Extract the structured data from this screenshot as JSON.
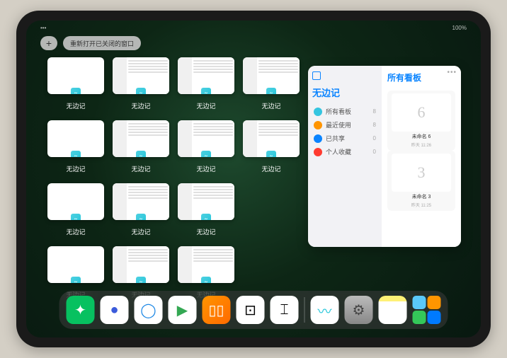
{
  "status": {
    "battery": "100%",
    "signal": "•••"
  },
  "top": {
    "plus": "+",
    "reopen_label": "重新打开已关闭的窗口"
  },
  "window_grid": {
    "app_label": "无边记",
    "rows": [
      [
        "blank",
        "content",
        "content",
        "content"
      ],
      [
        "blank",
        "content",
        "content",
        "content"
      ],
      [
        "blank",
        "content",
        "content",
        null
      ],
      [
        "blank",
        "content",
        "content",
        null
      ]
    ]
  },
  "panel": {
    "title": "无边记",
    "items": [
      {
        "icon_color": "#34c5e0",
        "label": "所有看板",
        "count": "8"
      },
      {
        "icon_color": "#ff9500",
        "label": "最近使用",
        "count": "8"
      },
      {
        "icon_color": "#0a84ff",
        "label": "已共享",
        "count": "0"
      },
      {
        "icon_color": "#ff3b30",
        "label": "个人收藏",
        "count": "0"
      }
    ],
    "right_title": "所有看板",
    "menu_dots": "•••",
    "boards": [
      {
        "glyph": "6",
        "name": "未命名 6",
        "time": "昨天 11:26"
      },
      {
        "glyph": "3",
        "name": "未命名 3",
        "time": "昨天 11:25"
      }
    ]
  },
  "dock": {
    "apps": [
      {
        "name": "wechat",
        "bg": "#07c160",
        "glyph": "✦",
        "glyph_color": "#fff"
      },
      {
        "name": "quark",
        "bg": "#fff",
        "glyph": "●",
        "glyph_color": "#3b5bdb"
      },
      {
        "name": "qqbrowser",
        "bg": "#fff",
        "glyph": "◯",
        "glyph_color": "#1e88e5"
      },
      {
        "name": "play",
        "bg": "#fff",
        "glyph": "▶",
        "glyph_color": "#34a853"
      },
      {
        "name": "books",
        "bg": "linear-gradient(135deg,#ff9500,#ff6a00)",
        "glyph": "▯▯",
        "glyph_color": "#fff"
      },
      {
        "name": "dice",
        "bg": "#fff",
        "glyph": "⊡",
        "glyph_color": "#000"
      },
      {
        "name": "connect",
        "bg": "#fff",
        "glyph": "⌶",
        "glyph_color": "#000"
      }
    ],
    "recents": [
      {
        "name": "freeform",
        "bg": "#fff",
        "glyph": "〰",
        "glyph_color": "#26c6da"
      },
      {
        "name": "settings",
        "bg": "linear-gradient(#bbb,#888)",
        "glyph": "⚙",
        "glyph_color": "#444"
      },
      {
        "name": "notes",
        "bg": "linear-gradient(#fff176 20%,#fff 20%)",
        "glyph": "",
        "glyph_color": "#000"
      }
    ],
    "stack_colors": [
      "#5ac8fa",
      "#ff9500",
      "#34c759",
      "#007aff"
    ]
  }
}
